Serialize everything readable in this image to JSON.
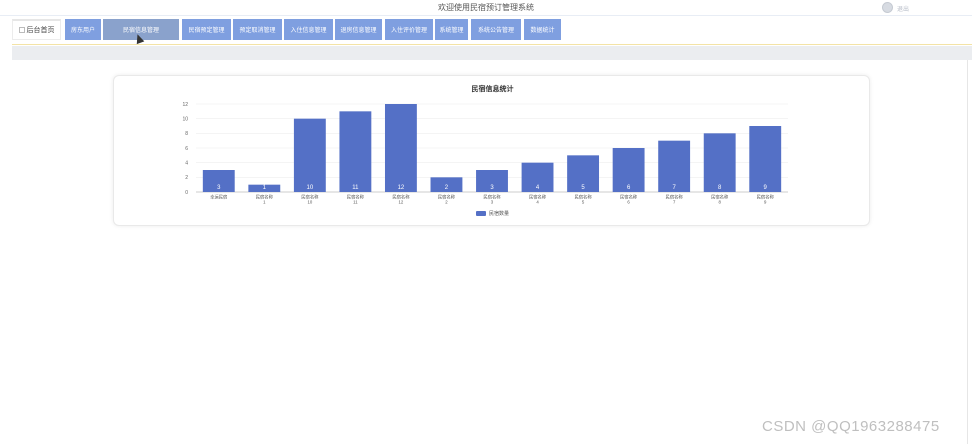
{
  "header": {
    "title": "欢迎使用民宿预订管理系统",
    "user_text": "",
    "logout_label": "退出"
  },
  "nav": {
    "home_label": "后台首页",
    "items": [
      {
        "label": "房东用户"
      },
      {
        "label": "民宿信息管理",
        "active": true
      },
      {
        "label": "民宿预定管理"
      },
      {
        "label": "预定取消管理"
      },
      {
        "label": "入住信息管理"
      },
      {
        "label": "退房信息管理"
      },
      {
        "label": "入住评价管理"
      },
      {
        "label": "系统管理"
      },
      {
        "label": "系统公告管理"
      },
      {
        "label": "数据统计"
      }
    ]
  },
  "chart_data": {
    "type": "bar",
    "title": "民宿信息统计",
    "categories": [
      "幸运民宿",
      "民宿名称1",
      "民宿名称10",
      "民宿名称11",
      "民宿名称12",
      "民宿名称2",
      "民宿名称3",
      "民宿名称4",
      "民宿名称5",
      "民宿名称6",
      "民宿名称7",
      "民宿名称8",
      "民宿名称9"
    ],
    "series": [
      {
        "name": "民宿数量",
        "values": [
          3,
          1,
          10,
          11,
          12,
          2,
          3,
          4,
          5,
          6,
          7,
          8,
          9
        ]
      }
    ],
    "ylim": [
      0,
      12
    ],
    "yticks": [
      0,
      2,
      4,
      6,
      8,
      10,
      12
    ],
    "grid": true,
    "legend": "bottom-center",
    "bar_color": "#5470c6",
    "data_labels": "inside-bottom"
  },
  "watermark": "CSDN @QQ1963288475"
}
